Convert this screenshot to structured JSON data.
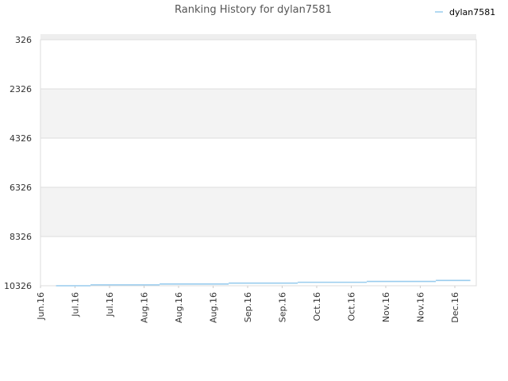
{
  "chart_data": {
    "type": "line",
    "title": "Ranking History for dylan7581",
    "xlabel": "",
    "ylabel": "",
    "y_reversed": true,
    "ylim": [
      326,
      10326
    ],
    "y_ticks": [
      326,
      2326,
      4326,
      6326,
      8326,
      10326
    ],
    "x_tick_labels": [
      "Jun.16",
      "Jul.16",
      "Jul.16",
      "Aug.16",
      "Aug.16",
      "Aug.16",
      "Sep.16",
      "Sep.16",
      "Oct.16",
      "Oct.16",
      "Nov.16",
      "Nov.16",
      "Dec.16"
    ],
    "grid": true,
    "legend_position": "top-right",
    "series": [
      {
        "name": "dylan7581",
        "color": "#99ccee",
        "steps": [
          {
            "x_start": 0.45,
            "x_end": 1.45,
            "rank": 10326
          },
          {
            "x_start": 1.45,
            "x_end": 3.45,
            "rank": 10290
          },
          {
            "x_start": 3.45,
            "x_end": 5.45,
            "rank": 10255
          },
          {
            "x_start": 5.45,
            "x_end": 7.45,
            "rank": 10220
          },
          {
            "x_start": 7.45,
            "x_end": 9.45,
            "rank": 10185
          },
          {
            "x_start": 9.45,
            "x_end": 11.45,
            "rank": 10150
          },
          {
            "x_start": 11.45,
            "x_end": 12.45,
            "rank": 10110
          }
        ]
      }
    ]
  }
}
